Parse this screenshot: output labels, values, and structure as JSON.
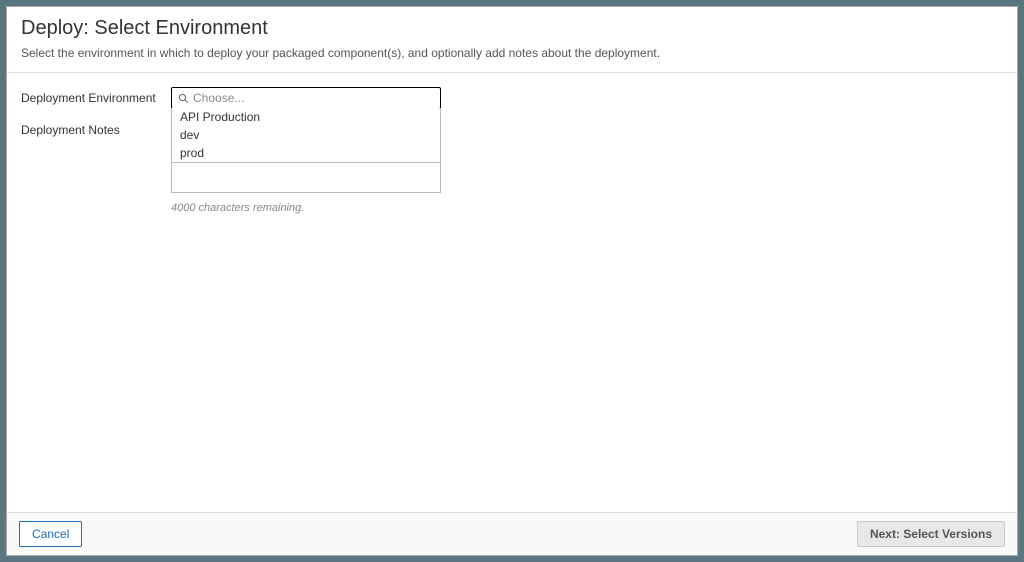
{
  "header": {
    "title": "Deploy: Select Environment",
    "subtitle": "Select the environment in which to deploy your packaged component(s), and optionally add notes about the deployment."
  },
  "form": {
    "environment_label": "Deployment Environment",
    "notes_label": "Deployment Notes",
    "combo_placeholder": "Choose...",
    "options": {
      "0": "API Production",
      "1": "dev",
      "2": "prod"
    },
    "notes_value": "",
    "helper_text": "4000 characters remaining."
  },
  "footer": {
    "cancel_label": "Cancel",
    "next_label": "Next: Select Versions"
  }
}
